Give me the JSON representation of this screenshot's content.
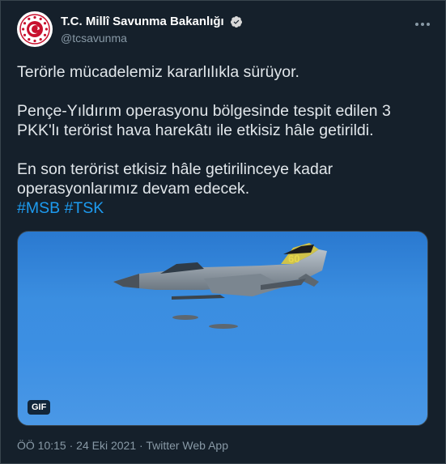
{
  "author": {
    "display_name": "T.C. Millî Savunma Bakanlığı",
    "handle": "@tcsavunma"
  },
  "tweet": {
    "line1": "Terörle mücadelemiz kararlılıkla sürüyor.",
    "para2": "Pençe-Yıldırım operasyonu bölgesinde tespit edilen 3 PKK'lı terörist hava harekâtı ile etkisiz hâle getirildi.",
    "para3": "En son terörist etkisiz hâle getirilinceye kadar operasyonlarımız devam edecek.",
    "hashtags": [
      "#MSB",
      "#TSK"
    ]
  },
  "media": {
    "badge": "GIF",
    "tail_number": "60"
  },
  "meta": {
    "time": "ÖÖ 10:15",
    "separator1": " · ",
    "date": "24 Eki 2021",
    "separator2": " · ",
    "source": "Twitter Web App"
  },
  "colors": {
    "background": "#15202b",
    "link": "#1d9bf0",
    "muted": "#8899a6",
    "verified": "#1d9bf0"
  }
}
